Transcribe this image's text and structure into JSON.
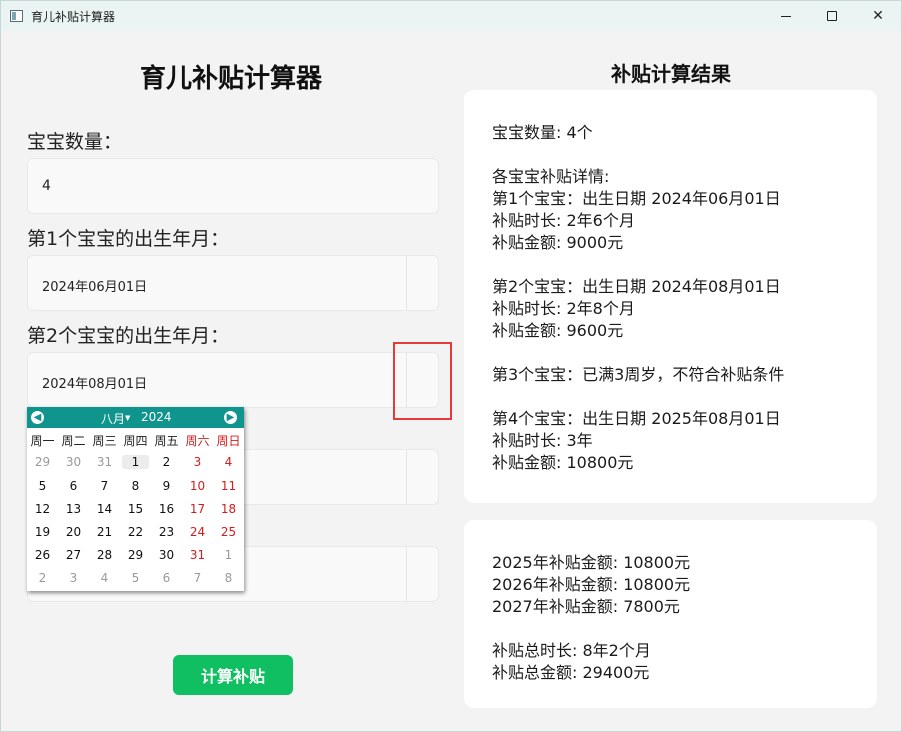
{
  "window": {
    "title": "育儿补贴计算器"
  },
  "form": {
    "title": "育儿补贴计算器",
    "count_label": "宝宝数量：",
    "count_value": "4",
    "baby1_label": "第1个宝宝的出生年月：",
    "baby1_value": "2024年06月01日",
    "baby2_label": "第2个宝宝的出生年月：",
    "baby2_value": "2024年08月01日",
    "calc_button": "计算补贴"
  },
  "calendar": {
    "month": "八月",
    "year": "2024",
    "weekdays": [
      "周一",
      "周二",
      "周三",
      "周四",
      "周五",
      "周六",
      "周日"
    ],
    "weeks": [
      [
        "29",
        "30",
        "31",
        "1",
        "2",
        "3",
        "4"
      ],
      [
        "5",
        "6",
        "7",
        "8",
        "9",
        "10",
        "11"
      ],
      [
        "12",
        "13",
        "14",
        "15",
        "16",
        "17",
        "18"
      ],
      [
        "19",
        "20",
        "21",
        "22",
        "23",
        "24",
        "25"
      ],
      [
        "26",
        "27",
        "28",
        "29",
        "30",
        "31",
        "1"
      ],
      [
        "2",
        "3",
        "4",
        "5",
        "6",
        "7",
        "8"
      ]
    ]
  },
  "result": {
    "title": "补贴计算结果",
    "card1_lines": [
      "宝宝数量: 4个",
      "",
      "各宝宝补贴详情:",
      "第1个宝宝：出生日期 2024年06月01日",
      "补贴时长: 2年6个月",
      "补贴金额: 9000元",
      "",
      "第2个宝宝：出生日期 2024年08月01日",
      "补贴时长: 2年8个月",
      "补贴金额: 9600元",
      "",
      "第3个宝宝：已满3周岁，不符合补贴条件",
      "",
      "第4个宝宝：出生日期 2025年08月01日",
      "补贴时长: 3年",
      "补贴金额: 10800元"
    ],
    "card2_lines": [
      "2025年补贴金额: 10800元",
      "2026年补贴金额: 10800元",
      "2027年补贴金额: 7800元",
      "",
      "补贴总时长: 8年2个月",
      "补贴总金额: 29400元"
    ]
  },
  "colors": {
    "accent": "#0fbf62",
    "calendar_header": "#10948e",
    "weekend": "#d21d1d",
    "highlight": "#e33b3b"
  },
  "icons": {
    "app": "app-icon",
    "minimize": "minimize-icon",
    "maximize": "maximize-icon",
    "close": "close-icon",
    "prev": "arrow-left-icon",
    "next": "arrow-right-icon"
  }
}
